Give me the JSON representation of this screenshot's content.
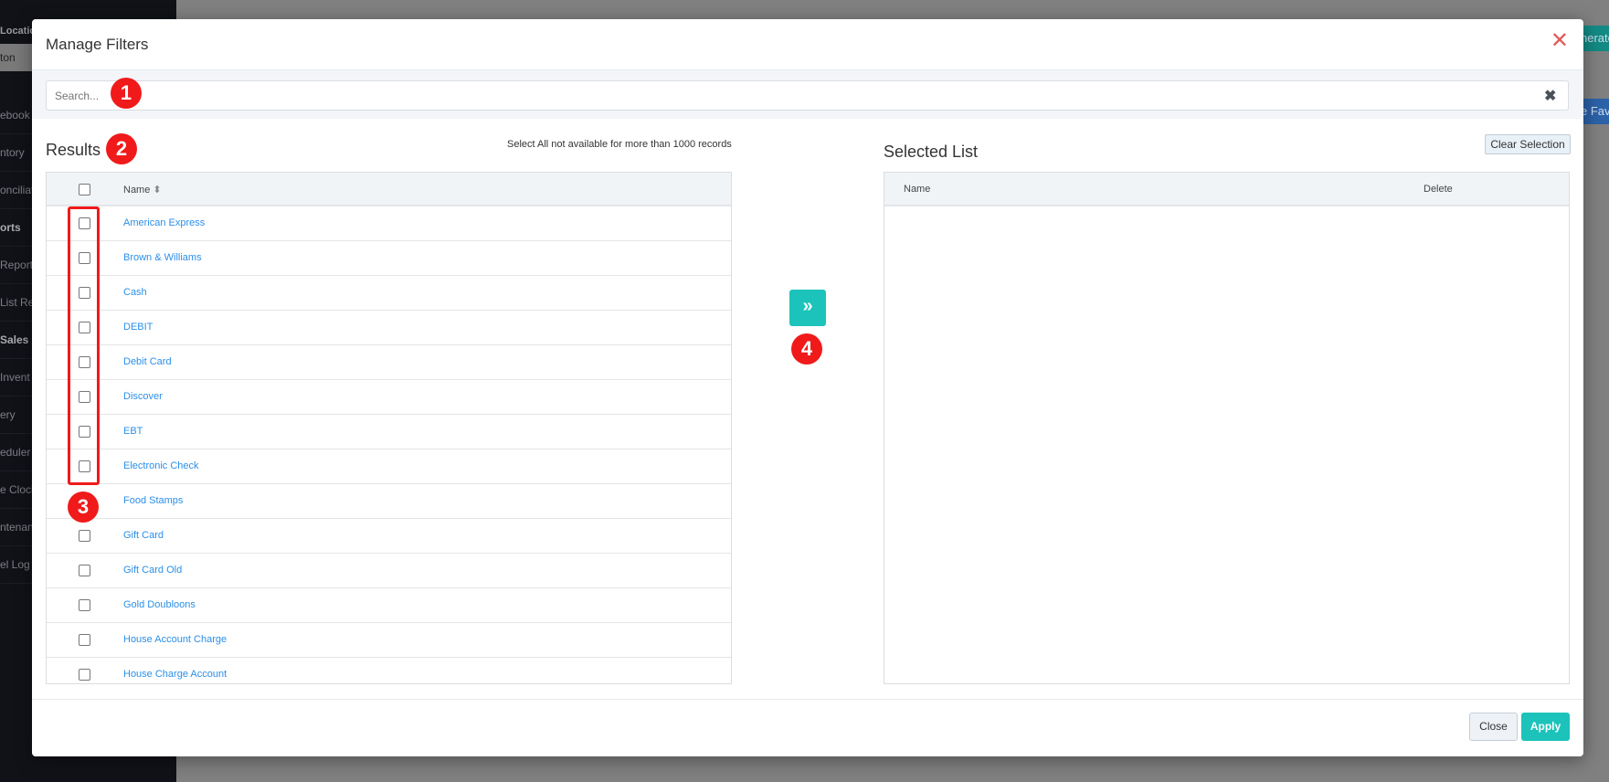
{
  "background": {
    "location_label": "Location",
    "location_value": "ton",
    "sidebar": [
      {
        "label": "ebook",
        "bold": false
      },
      {
        "label": "ntory",
        "bold": false
      },
      {
        "label": "onciliatio",
        "bold": false
      },
      {
        "label": "orts",
        "bold": true
      },
      {
        "label": "Report",
        "bold": false
      },
      {
        "label": "List Re",
        "bold": false
      },
      {
        "label": "Sales",
        "bold": true
      },
      {
        "label": "Invent",
        "bold": false
      },
      {
        "label": "ery",
        "bold": false
      },
      {
        "label": "eduler",
        "bold": false
      },
      {
        "label": "e Clock",
        "bold": false
      },
      {
        "label": "ntenanc",
        "bold": false
      },
      {
        "label": "el Log",
        "bold": false
      }
    ],
    "generate_label": "nerate",
    "favorite_label": "e Fav"
  },
  "modal": {
    "title": "Manage Filters",
    "search_placeholder": "Search...",
    "results_title": "Results",
    "select_all_notice": "Select All not available for more than 1000 records",
    "name_header": "Name",
    "results": [
      "American Express",
      "Brown & Williams",
      "Cash",
      "DEBIT",
      "Debit Card",
      "Discover",
      "EBT",
      "Electronic Check",
      "Food Stamps",
      "Gift Card",
      "Gift Card Old",
      "Gold Doubloons",
      "House Account Charge",
      "House Charge Account"
    ],
    "move_button": "»",
    "selected_title": "Selected List",
    "clear_selection": "Clear Selection",
    "selected_name_header": "Name",
    "selected_delete_header": "Delete",
    "close_button": "Close",
    "apply_button": "Apply"
  },
  "annotations": [
    "1",
    "2",
    "3",
    "4"
  ],
  "colors": {
    "accent": "#1cc3bb",
    "link": "#2b8fe8",
    "annotation": "#f01a1a"
  }
}
